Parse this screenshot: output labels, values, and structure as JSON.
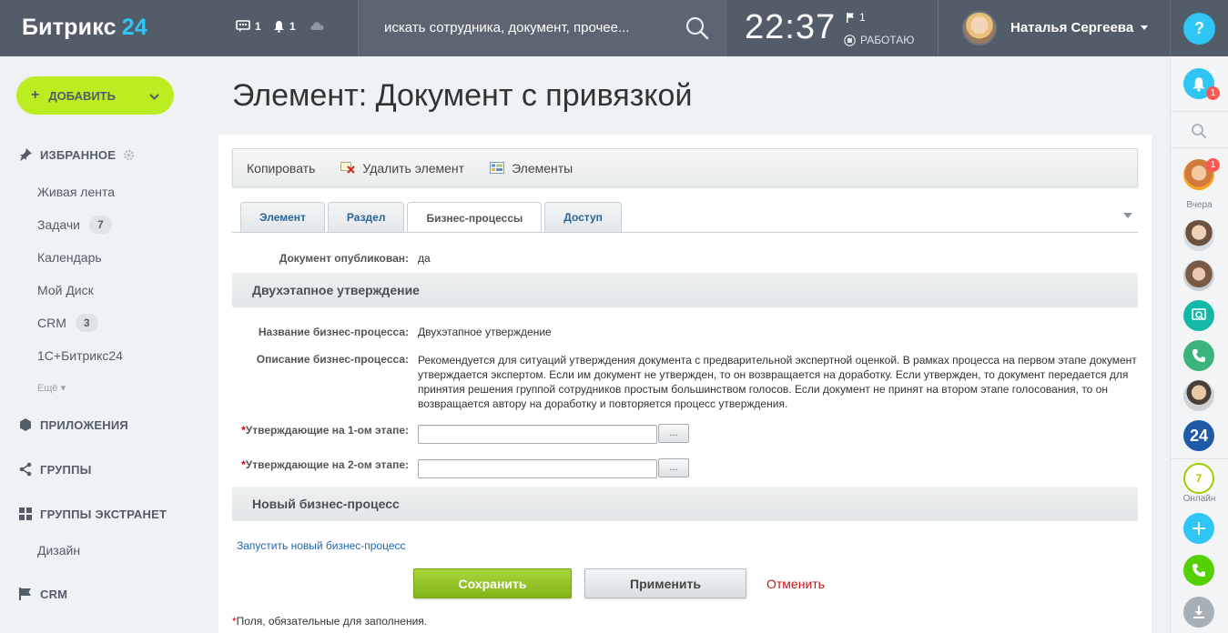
{
  "header": {
    "logo_text": "Битрикс",
    "logo_num": "24",
    "chat_count": "1",
    "notif_count": "1",
    "search_placeholder": "искать сотрудника, документ, прочее...",
    "clock": "22:37",
    "flag_count": "1",
    "work_status": "РАБОТАЮ",
    "user_name": "Наталья Сергеева",
    "help_label": "?"
  },
  "sidebar": {
    "add_button": "ДОБАВИТЬ",
    "favorites": "ИЗБРАННОЕ",
    "items": [
      {
        "label": "Живая лента",
        "badge": ""
      },
      {
        "label": "Задачи",
        "badge": "7"
      },
      {
        "label": "Календарь",
        "badge": ""
      },
      {
        "label": "Мой Диск",
        "badge": ""
      },
      {
        "label": "CRM",
        "badge": "3"
      },
      {
        "label": "1С+Битрикс24",
        "badge": ""
      }
    ],
    "more": "Ещё",
    "apps": "ПРИЛОЖЕНИЯ",
    "groups": "ГРУППЫ",
    "extranet": "ГРУППЫ ЭКСТРАНЕТ",
    "design": "Дизайн",
    "crm": "CRM"
  },
  "main": {
    "title": "Элемент: Документ с привязкой",
    "toolbar": {
      "copy": "Копировать",
      "delete": "Удалить элемент",
      "elements": "Элементы"
    },
    "tabs": [
      "Элемент",
      "Раздел",
      "Бизнес-процессы",
      "Доступ"
    ],
    "active_tab": "Бизнес-процессы",
    "published_label": "Документ опубликован:",
    "published_value": "да",
    "section1": "Двухэтапное утверждение",
    "bp_name_label": "Название бизнес-процесса:",
    "bp_name_value": "Двухэтапное утверждение",
    "bp_desc_label": "Описание бизнес-процесса:",
    "bp_desc_value": "Рекомендуется для ситуаций утверждения документа с предварительной экспертной оценкой. В рамках процесса на первом этапе документ утверждается экспертом. Если им документ не утвержден, то он возвращается на доработку. Если утвержден, то документ передается для принятия решения группой сотрудников простым большинством голосов. Если документ не принят на втором этапе голосования, то он возвращается автору на доработку и повторяется процесс утверждения.",
    "stage1_label": "Утверждающие на 1-ом этапе:",
    "stage2_label": "Утверждающие на 2-ом этапе:",
    "stage1_value": "",
    "stage2_value": "",
    "dots_label": "...",
    "required_mark": "*",
    "section2": "Новый бизнес-процесс",
    "start_link": "Запустить новый бизнес-процесс",
    "save": "Сохранить",
    "apply": "Применить",
    "cancel": "Отменить",
    "footnote": "Поля, обязательные для заполнения."
  },
  "rail": {
    "notif_badge": "1",
    "chat_badge": "1",
    "yesterday": "Вчера",
    "online_count": "7",
    "online_label": "Онлайн",
    "b24_label": "24"
  },
  "colors": {
    "header_bg": "#535c69",
    "accent_green": "#bbed21",
    "accent_blue": "#2fc6f6",
    "save_green": "#82b417",
    "cancel_red": "#c0151a"
  }
}
